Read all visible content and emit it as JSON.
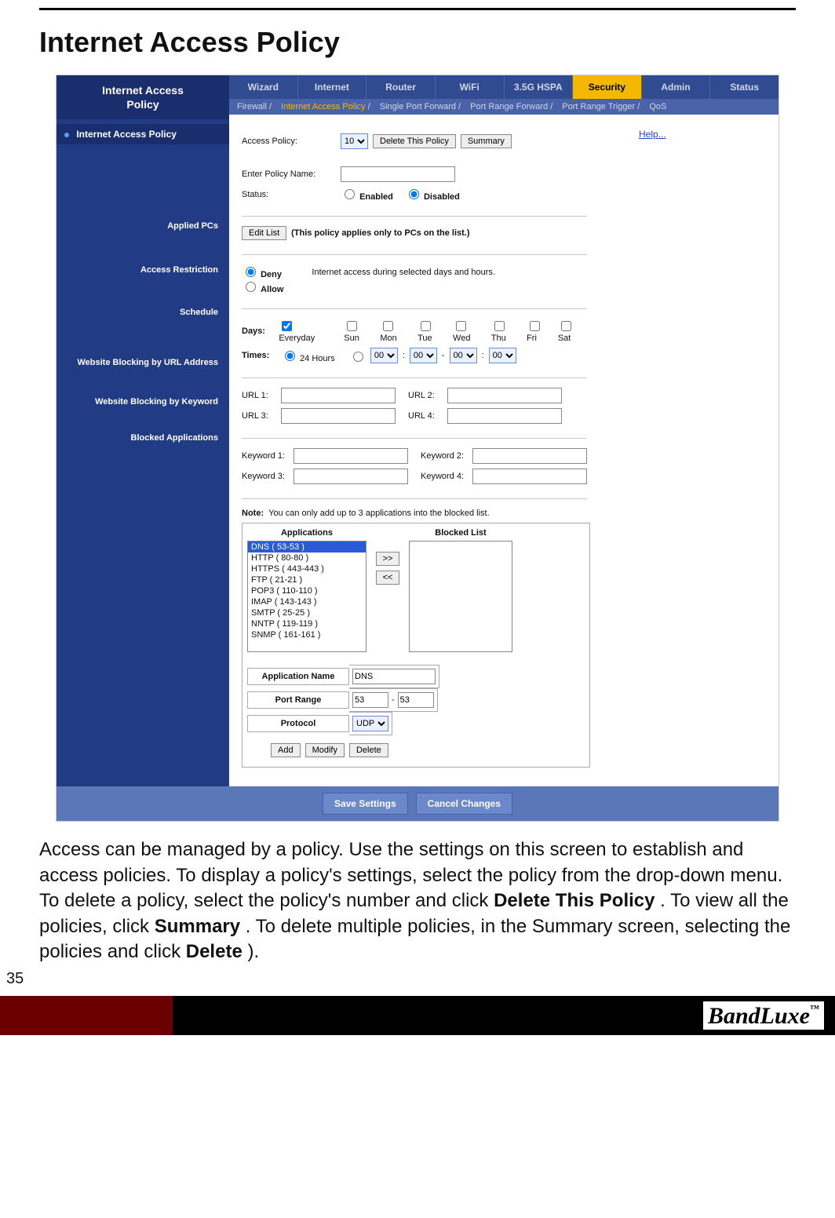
{
  "doc": {
    "page_title": "Internet Access Policy",
    "page_number": "35",
    "brand": "BandLuxe",
    "brand_tm": "™",
    "body_html_parts": {
      "p1a": "Access can be managed by a policy. Use the settings on this screen to establish and access policies. To display a policy's settings, select the policy from the drop-down menu. To delete a policy, select the policy's number and click ",
      "b1": "Delete This Policy",
      "p1b": ". To view all the policies, click ",
      "b2": "Summary",
      "p1c": ". To delete multiple policies, in the Summary screen, selecting the policies and click ",
      "b3": "Delete",
      "p1d": ")."
    }
  },
  "ui": {
    "sidebar_title_line1": "Internet Access",
    "sidebar_title_line2": "Policy",
    "help_link": "Help...",
    "tabs": {
      "wizard": "Wizard",
      "internet": "Internet",
      "router": "Router",
      "wifi": "WiFi",
      "hspa": "3.5G HSPA",
      "security": "Security",
      "admin": "Admin",
      "status": "Status"
    },
    "subtabs": {
      "firewall": "Firewall",
      "iap": "Internet Access Policy",
      "spf": "Single Port Forward",
      "prf": "Port Range Forward",
      "prt": "Port Range Trigger",
      "qos": "QoS"
    },
    "nav": {
      "iap": "Internet Access Policy",
      "applied_pcs": "Applied PCs",
      "access_restriction": "Access Restriction",
      "schedule": "Schedule",
      "wb_url": "Website Blocking by URL Address",
      "wb_kw": "Website Blocking by Keyword",
      "blocked_apps": "Blocked Applications"
    },
    "policy": {
      "access_policy_label": "Access Policy:",
      "access_policy_value": "10",
      "delete_btn": "Delete This Policy",
      "summary_btn": "Summary",
      "policy_name_label": "Enter Policy Name:",
      "policy_name_value": "",
      "status_label": "Status:",
      "enabled": "Enabled",
      "disabled": "Disabled"
    },
    "applied": {
      "edit_btn": "Edit List",
      "note": "(This policy applies only to PCs on the list.)"
    },
    "restriction": {
      "deny": "Deny",
      "allow": "Allow",
      "note": "Internet access during selected days and hours."
    },
    "schedule": {
      "days_label": "Days:",
      "everyday": "Everyday",
      "sun": "Sun",
      "mon": "Mon",
      "tue": "Tue",
      "wed": "Wed",
      "thu": "Thu",
      "fri": "Fri",
      "sat": "Sat",
      "times_label": "Times:",
      "t24": "24 Hours",
      "hh": "00",
      "mm": "00",
      "hh2": "00",
      "mm2": "00"
    },
    "urls": {
      "u1": "URL 1:",
      "u2": "URL 2:",
      "u3": "URL 3:",
      "u4": "URL 4:"
    },
    "kw": {
      "k1": "Keyword 1:",
      "k2": "Keyword 2:",
      "k3": "Keyword 3:",
      "k4": "Keyword 4:"
    },
    "apps": {
      "note": "Note: You can only add up to 3 applications into the blocked list.",
      "col_apps": "Applications",
      "col_blocked": "Blocked List",
      "move_right": ">>",
      "move_left": "<<",
      "list": [
        "DNS ( 53-53 )",
        "HTTP ( 80-80 )",
        "HTTPS ( 443-443 )",
        "FTP ( 21-21 )",
        "POP3 ( 110-110 )",
        "IMAP ( 143-143 )",
        "SMTP ( 25-25 )",
        "NNTP ( 119-119 )",
        "SNMP ( 161-161 )"
      ],
      "app_name_label": "Application Name",
      "app_name_value": "DNS",
      "port_range_label": "Port Range",
      "port_from": "53",
      "port_to": "53",
      "protocol_label": "Protocol",
      "protocol_value": "UDP",
      "add_btn": "Add",
      "modify_btn": "Modify",
      "delete_btn": "Delete"
    },
    "footer": {
      "save": "Save Settings",
      "cancel": "Cancel Changes"
    }
  }
}
